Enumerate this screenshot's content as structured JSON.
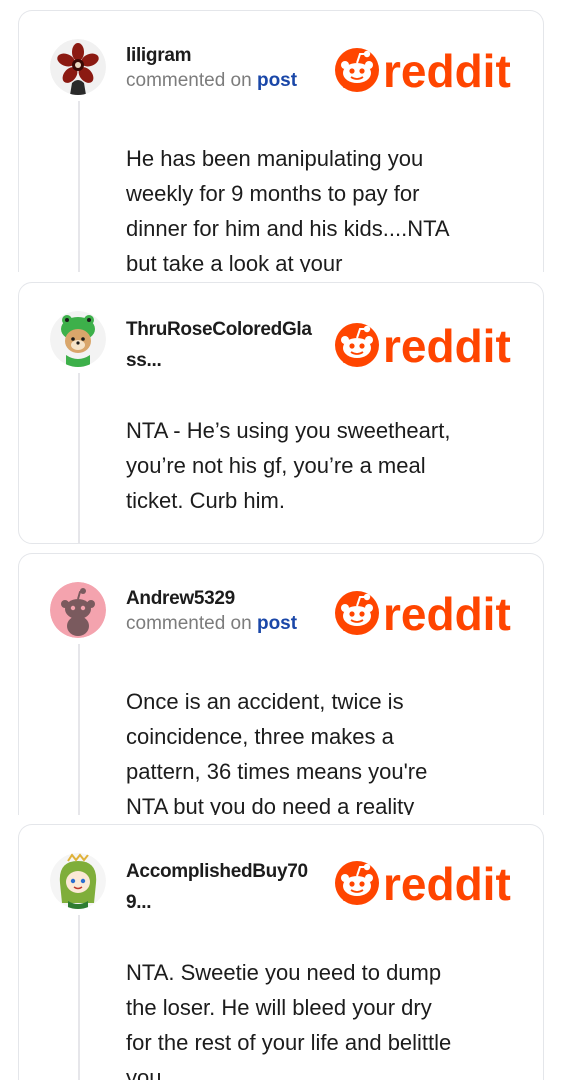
{
  "brand": {
    "name": "reddit",
    "color": "#ff4500",
    "logo_icon": "reddit-snoo-icon"
  },
  "cards": [
    {
      "username": "liligram",
      "action": "commented on ",
      "action_link": "post",
      "avatar_icon": "demogorgon-flower-avatar",
      "text": "He has been manipulating you\nweekly for 9 months to pay for\ndinner for him and his kids....NTA\nbut take a look at your"
    },
    {
      "username": "ThruRoseColoredGla\nss...",
      "avatar_icon": "dog-in-frog-hood-avatar",
      "text": "NTA - He’s using you sweetheart,\nyou’re not his gf, you’re a meal\nticket. Curb him."
    },
    {
      "username": "Andrew5329",
      "action": "commented on ",
      "action_link": "post",
      "avatar_icon": "default-snoo-avatar",
      "text": "Once is an accident, twice is\ncoincidence, three makes a\npattern, 36 times means you're\nNTA but you do need a reality"
    },
    {
      "username": "AccomplishedBuy70\n9...",
      "avatar_icon": "green-hair-snoo-avatar",
      "text": "NTA. Sweetie you need to dump\nthe loser. He will bleed your dry\nfor the rest of your life and belittle\nyou"
    }
  ]
}
